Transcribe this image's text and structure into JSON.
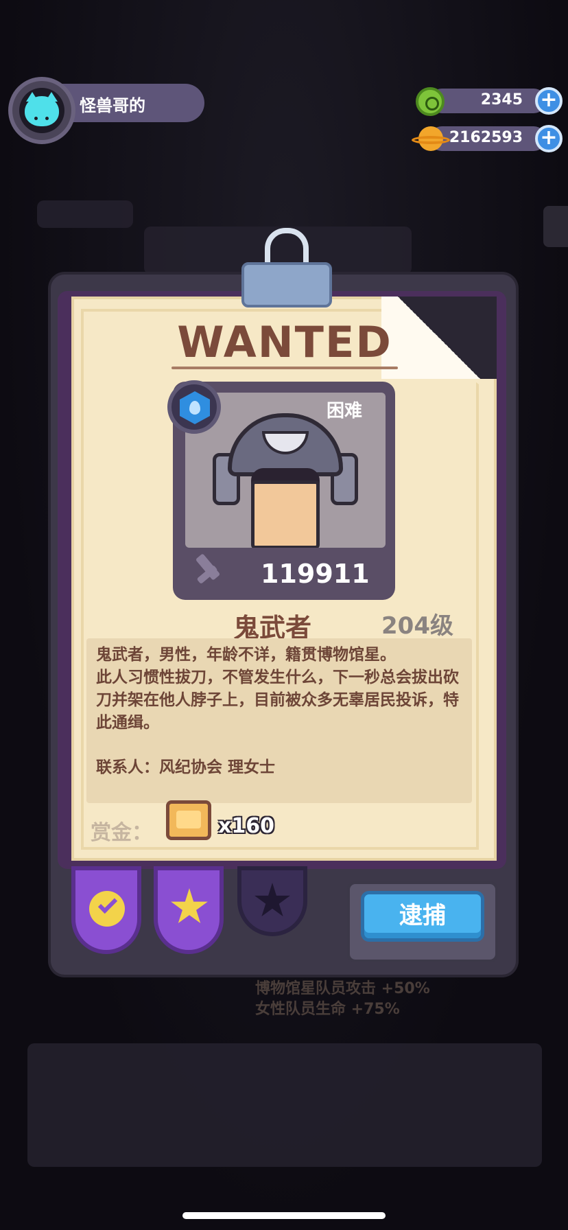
{
  "header": {
    "player_name": "怪兽哥的",
    "currencies": [
      {
        "icon": "gem-icon",
        "value": "2345"
      },
      {
        "icon": "coin-icon",
        "value": "2162593"
      }
    ],
    "plus": "+"
  },
  "wanted_card": {
    "title": "WANTED",
    "difficulty": "困难",
    "power": "119911",
    "name": "鬼武者",
    "level": "204级",
    "description": "鬼武者，男性，年龄不详，籍贯博物馆星。\n此人习惯性拔刀，不管发生什么，下一秒总会拔出砍刀并架在他人脖子上，目前被众多无辜居民投诉，特此通缉。",
    "contact": "联系人：风纪协会 理女士",
    "reward_label": "赏金：",
    "reward_qty": "x160",
    "capture_button": "逮捕"
  },
  "background": {
    "bonus_lines": [
      "博物馆星队员攻击 +50%",
      "女性队员生命 +75%"
    ]
  },
  "colors": {
    "accent": "#49b3ef",
    "tab": "#8a4fd2",
    "paper": "#f6e8c6",
    "ink": "#7b4a3a"
  }
}
